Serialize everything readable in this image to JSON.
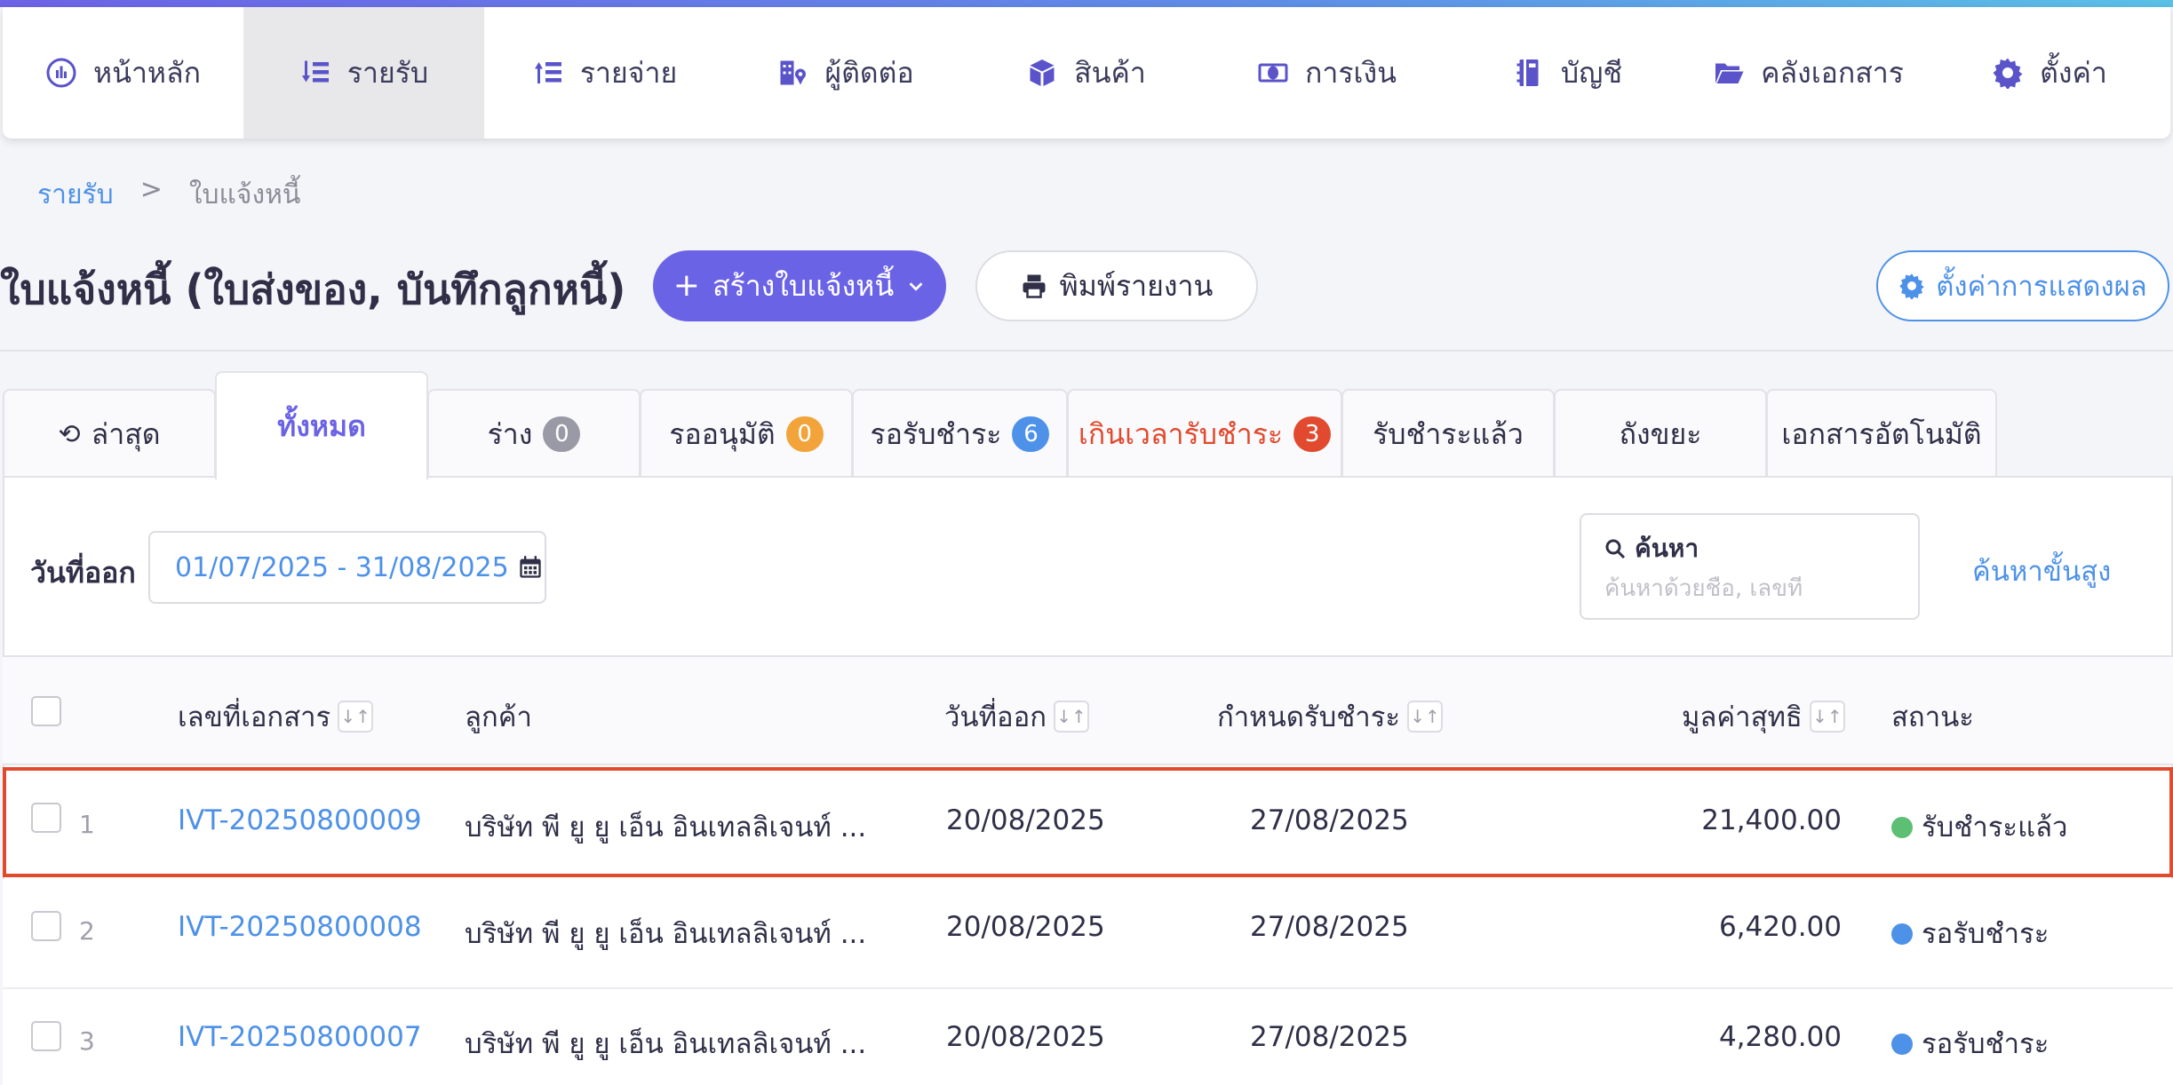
{
  "nav": {
    "items": [
      {
        "label": "หน้าหลัก",
        "icon": "dashboard-icon"
      },
      {
        "label": "รายรับ",
        "icon": "income-icon",
        "active": true
      },
      {
        "label": "รายจ่าย",
        "icon": "expense-icon"
      },
      {
        "label": "ผู้ติดต่อ",
        "icon": "contacts-icon"
      },
      {
        "label": "สินค้า",
        "icon": "product-icon"
      },
      {
        "label": "การเงิน",
        "icon": "money-icon"
      },
      {
        "label": "บัญชี",
        "icon": "accounting-icon"
      },
      {
        "label": "คลังเอกสาร",
        "icon": "folder-icon"
      },
      {
        "label": "ตั้งค่า",
        "icon": "gear-icon"
      }
    ]
  },
  "breadcrumb": {
    "parent": "รายรับ",
    "separator": ">",
    "current": "ใบแจ้งหนี้"
  },
  "page": {
    "title": "ใบแจ้งหนี้ (ใบส่งของ, บันทึกลูกหนี้)",
    "create_label": "สร้างใบแจ้งหนี้",
    "print_label": "พิมพ์รายงาน",
    "display_settings_label": "ตั้งค่าการแสดงผล"
  },
  "tabs": [
    {
      "label": "ล่าสุด"
    },
    {
      "label": "ทั้งหมด"
    },
    {
      "label": "ร่าง",
      "count": "0",
      "badge_color": "#9a9aa6"
    },
    {
      "label": "รออนุมัติ",
      "count": "0",
      "badge_color": "#f2a33a"
    },
    {
      "label": "รอรับชำระ",
      "count": "6",
      "badge_color": "#4d91e8"
    },
    {
      "label": "เกินเวลารับชำระ",
      "count": "3",
      "badge_color": "#e14a2e"
    },
    {
      "label": "รับชำระแล้ว"
    },
    {
      "label": "ถังขยะ"
    },
    {
      "label": "เอกสารอัตโนมัติ"
    }
  ],
  "filters": {
    "date_label": "วันที่ออก",
    "date_range": "01/07/2025 - 31/08/2025",
    "search_label": "ค้นหา",
    "search_placeholder": "ค้นหาด้วยชื่อ, เลขที่",
    "advanced_search_label": "ค้นหาขั้นสูง"
  },
  "table": {
    "headers": {
      "doc_no": "เลขที่เอกสาร",
      "customer": "ลูกค้า",
      "issue_date": "วันที่ออก",
      "due_date": "กำหนดรับชำระ",
      "net_amount": "มูลค่าสุทธิ",
      "status": "สถานะ"
    },
    "rows": [
      {
        "no": "1",
        "doc_no": "IVT-20250800009",
        "customer": "บริษัท พี ยู ยู เอ็น อินเทลลิเจนท์ ...",
        "issue_date": "20/08/2025",
        "due_date": "27/08/2025",
        "net_amount": "21,400.00",
        "status": "รับชำระแล้ว",
        "status_color": "#5cbf74"
      },
      {
        "no": "2",
        "doc_no": "IVT-20250800008",
        "customer": "บริษัท พี ยู ยู เอ็น อินเทลลิเจนท์ ...",
        "issue_date": "20/08/2025",
        "due_date": "27/08/2025",
        "net_amount": "6,420.00",
        "status": "รอรับชำระ",
        "status_color": "#4d91e8"
      },
      {
        "no": "3",
        "doc_no": "IVT-20250800007",
        "customer": "บริษัท พี ยู ยู เอ็น อินเทลลิเจนท์ ...",
        "issue_date": "20/08/2025",
        "due_date": "27/08/2025",
        "net_amount": "4,280.00",
        "status": "รอรับชำระ",
        "status_color": "#4d91e8"
      }
    ]
  }
}
